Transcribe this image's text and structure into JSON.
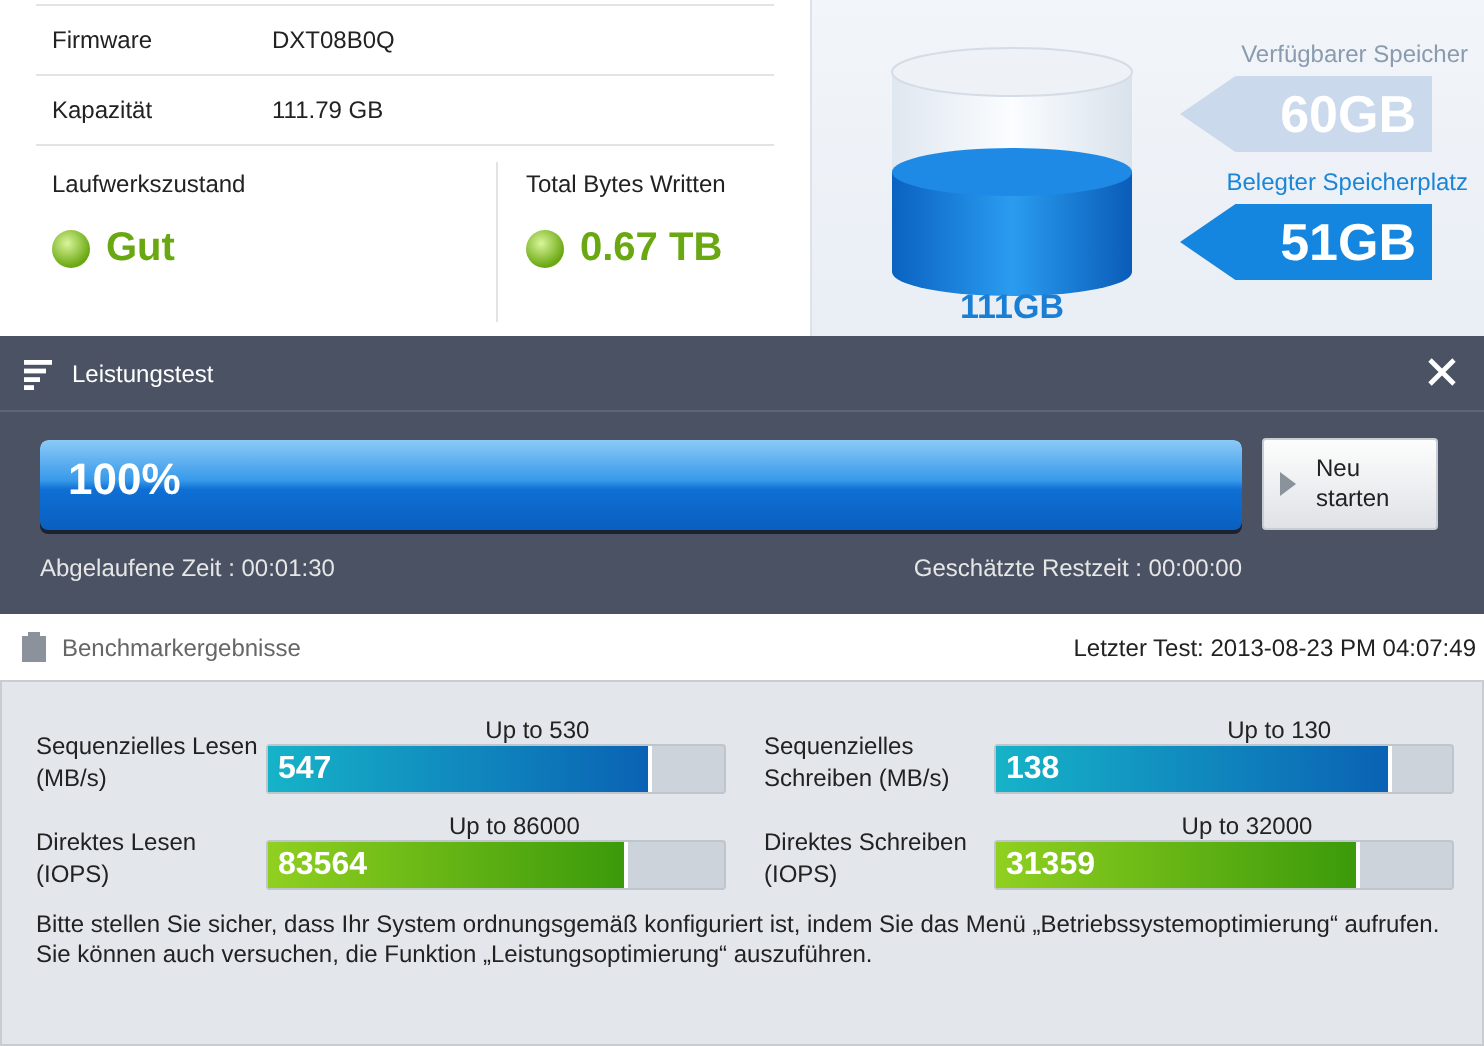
{
  "drive_info": {
    "rows": [
      {
        "label": "Firmware",
        "value": "DXT08B0Q"
      },
      {
        "label": "Kapazität",
        "value": "111.79 GB"
      }
    ],
    "health": {
      "label": "Laufwerkszustand",
      "value": "Gut",
      "color": "#6aa812"
    },
    "tbw": {
      "label": "Total Bytes Written",
      "value": "0.67 TB",
      "color": "#6aa812"
    }
  },
  "storage": {
    "total": "111GB",
    "available": {
      "label": "Verfügbarer Speicher",
      "value": "60GB"
    },
    "used": {
      "label": "Belegter Speicherplatz",
      "value": "51GB"
    }
  },
  "dialog": {
    "title": "Leistungstest",
    "progress": {
      "text": "100%",
      "level": 1.0
    },
    "restart_button": "Neu starten",
    "elapsed": "Abgelaufene Zeit : 00:01:30",
    "remaining": "Geschätzte Restzeit : 00:00:00",
    "results_title": "Benchmarkergebnisse",
    "last_test": "Letzter Test: 2013-08-23 PM 04:07:49",
    "benchmarks": [
      {
        "label": "Sequenzielles Lesen (MB/s)",
        "value": "547",
        "limit": "Up to 530",
        "kind": "sequential",
        "level": 0.84
      },
      {
        "label": "Sequenzielles Schreiben (MB/s)",
        "value": "138",
        "limit": "Up to 130",
        "kind": "sequential",
        "level": 0.87
      },
      {
        "label": "Direktes Lesen (IOPS)",
        "value": "83564",
        "limit": "Up to 86000",
        "kind": "random",
        "level": 0.79
      },
      {
        "label": "Direktes Schreiben (IOPS)",
        "value": "31359",
        "limit": "Up to 32000",
        "kind": "random",
        "level": 0.8
      }
    ],
    "hint": [
      "Bitte stellen Sie sicher, dass Ihr System ordnungsgemäß konfiguriert ist, indem Sie das Menü „Betriebssystemoptimierung“ aufrufen.",
      "Sie können auch versuchen, die Funktion „Leistungsoptimierung“ auszuführen."
    ]
  }
}
